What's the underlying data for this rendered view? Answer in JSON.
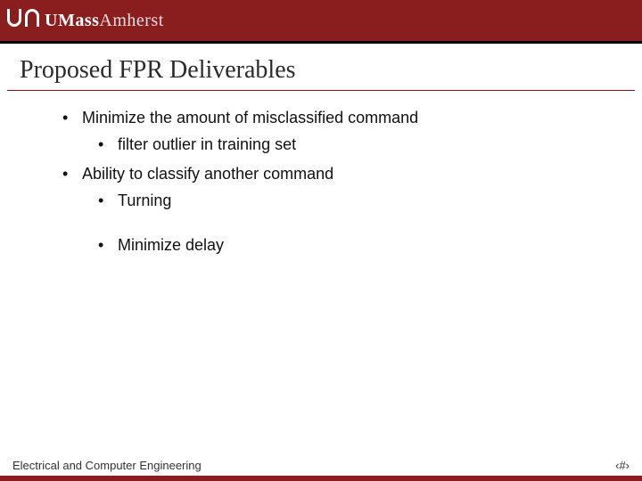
{
  "brand": {
    "part1": "UMass",
    "part2": "Amherst"
  },
  "title": "Proposed FPR Deliverables",
  "bullets": [
    {
      "text": "Minimize the amount of misclassified command",
      "sub": [
        {
          "text": "filter outlier in training set"
        }
      ]
    },
    {
      "text": "Ability to classify another command",
      "sub": [
        {
          "text": "Turning"
        },
        {
          "text": "Minimize delay"
        }
      ]
    }
  ],
  "footer": {
    "dept": "Electrical and Computer Engineering",
    "page": "‹#›"
  }
}
